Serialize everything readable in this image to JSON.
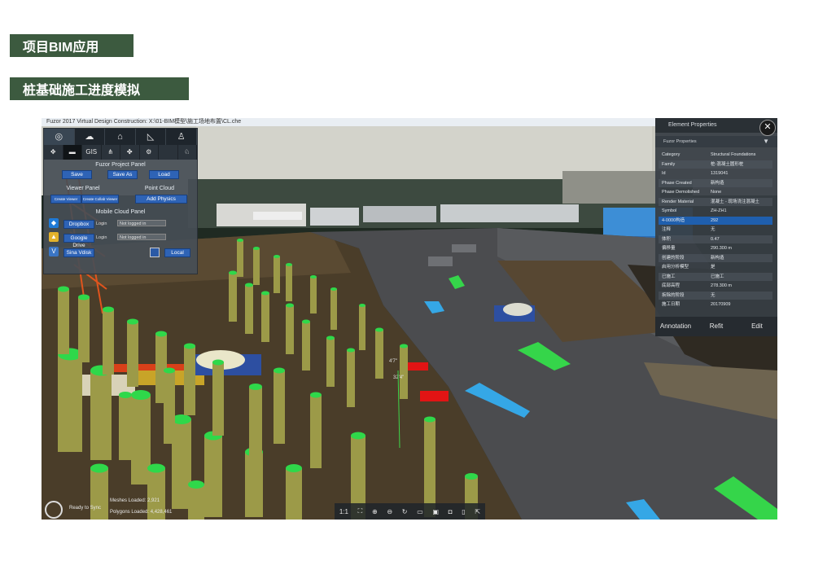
{
  "headings": {
    "section": "项目BIM应用",
    "subsection": "桩基础施工进度模拟"
  },
  "app": {
    "title": "Fuzor 2017 Virtual Design Construction: X:\\01-BIM模型\\施工场地布置\\CL.che",
    "left_panel": {
      "top_tabs": [
        "navigate-icon",
        "cloud-icon",
        "building-icon",
        "ruler-icon",
        "person-icon"
      ],
      "tool_tabs": [
        "move-icon",
        "folder-icon",
        "GIS",
        "hierarchy-icon",
        "puzzle-icon",
        "settings-icon",
        "",
        "walker-icon"
      ],
      "project_panel": {
        "title": "Fuzor Project Panel",
        "save": "Save",
        "save_as": "Save As",
        "load": "Load"
      },
      "viewer_panel": {
        "title": "Viewer Panel",
        "create_viewer": "Create Viewer",
        "create_collab": "Create Collab Viewer"
      },
      "point_cloud": {
        "title": "Point Cloud",
        "add_physics": "Add Physics"
      },
      "mobile_cloud": {
        "title": "Mobile Cloud Panel",
        "dropbox": "Dropbox",
        "google_drive": "Google Drive",
        "sina_vdisk": "Sina Vdisk",
        "login_label": "Login",
        "dropbox_status": "Not logged in",
        "google_status": "Not logged in",
        "local": "Local"
      }
    },
    "properties": {
      "title": "Element Properties",
      "subtitle": "Fuzor Properties",
      "rows": [
        {
          "k": "Category",
          "v": "Structural Foundations"
        },
        {
          "k": "Family",
          "v": "桩-混凝土圆形桩"
        },
        {
          "k": "Id",
          "v": "1319041"
        },
        {
          "k": "Phase Created",
          "v": "新构造"
        },
        {
          "k": "Phase Demolished",
          "v": "None"
        },
        {
          "k": "Render Material",
          "v": "混凝土 - 现场浇注混凝土"
        },
        {
          "k": "Symbol",
          "v": "ZH-ZH1"
        },
        {
          "k": "4-0000构造",
          "v": "292"
        },
        {
          "k": "注释",
          "v": "无"
        },
        {
          "k": "体积",
          "v": "0.47"
        },
        {
          "k": "偏移量",
          "v": "290.300 m"
        },
        {
          "k": "创建的阶段",
          "v": "新构造"
        },
        {
          "k": "启用分析模型",
          "v": "是"
        },
        {
          "k": "已施工",
          "v": "已施工"
        },
        {
          "k": "底部高程",
          "v": "278.300 m"
        },
        {
          "k": "拆除的阶段",
          "v": "无"
        },
        {
          "k": "施工日期",
          "v": "20170909"
        }
      ],
      "annotation": "Annotation",
      "refit": "Refit",
      "edit": "Edit"
    },
    "status": {
      "sync": "Ready to Sync",
      "meshes": "Meshes Loaded: 2,921",
      "polygons": "Polygons Loaded: 4,428,461"
    },
    "toolbar": {
      "ratio": "1:1",
      "icons": [
        "fit-icon",
        "zoom-in-icon",
        "zoom-out-icon",
        "rotate-icon",
        "clipboard-icon",
        "save-icon",
        "bookmark-icon",
        "mobile-icon",
        "export-icon"
      ]
    },
    "scene_labels": {
      "label_a": "4'7\"",
      "label_b": "32'4\""
    }
  },
  "colors": {
    "heading_bg": "#3c5a3f",
    "button_blue": "#2e63b6",
    "pile": "#9c9a48",
    "pile_top": "#2fd84a",
    "selected_row": "#1f5fae"
  }
}
